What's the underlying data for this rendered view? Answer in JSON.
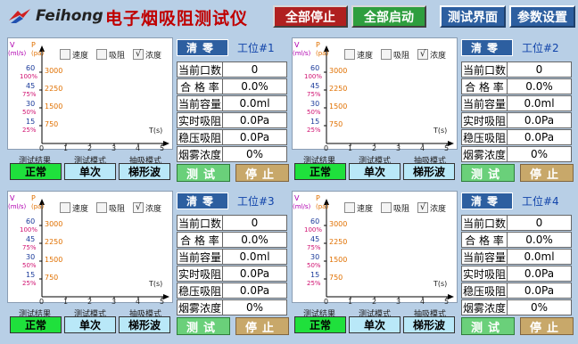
{
  "header": {
    "brand": "Feihong",
    "app_title": "电子烟吸阻测试仪",
    "stop_all": "全部停止",
    "start_all": "全部启动",
    "test_view": "测试界面",
    "params": "参数设置"
  },
  "colors": {
    "background": "#b8cfe6",
    "title_red": "#c00000",
    "result_green": "#1fe03c",
    "blue_button": "#2d5fa0",
    "test_green": "#6ad07a",
    "stop_tan": "#c8a86a"
  },
  "plot_labels": {
    "y1_unit_v": "V",
    "y1_unit": "(ml/s)",
    "y2_unit_p": "P",
    "y2_unit": "(pa)",
    "x_label": "T(s)",
    "y_ticks_left": [
      "60",
      "45",
      "30",
      "15"
    ],
    "y_ticks_pct": [
      "100%",
      "75%",
      "50%",
      "25%"
    ],
    "y_ticks_pa": [
      "3000",
      "2250",
      "1500",
      "750"
    ],
    "x_ticks": [
      "0",
      "1",
      "2",
      "3",
      "4",
      "5"
    ],
    "check_speed": "速度",
    "check_resistance": "吸阻",
    "check_concentration": "浓度",
    "check_mark": "√"
  },
  "labels": {
    "result_label": "测试结果",
    "mode_label": "测试模式",
    "wave_label": "抽吸模式",
    "zero_btn": "清零",
    "test_btn": "测试",
    "stop_btn": "停止",
    "current_puffs": "当前口数",
    "pass_rate": "合 格 率",
    "current_volume": "当前容量",
    "realtime_resistance": "实时吸阻",
    "steady_resistance": "稳压吸阻",
    "smoke_concentration": "烟雾浓度"
  },
  "stations": [
    {
      "title": "工位#1",
      "checks": {
        "speed": false,
        "resistance": false,
        "concentration": true
      },
      "result": "正常",
      "mode": "单次",
      "wave": "梯形波",
      "current_puffs": "0",
      "pass_rate": "0.0%",
      "current_volume": "0.0ml",
      "realtime_resistance": "0.0Pa",
      "steady_resistance": "0.0Pa",
      "smoke_concentration": "0%"
    },
    {
      "title": "工位#2",
      "checks": {
        "speed": false,
        "resistance": false,
        "concentration": true
      },
      "result": "正常",
      "mode": "单次",
      "wave": "梯形波",
      "current_puffs": "0",
      "pass_rate": "0.0%",
      "current_volume": "0.0ml",
      "realtime_resistance": "0.0Pa",
      "steady_resistance": "0.0Pa",
      "smoke_concentration": "0%"
    },
    {
      "title": "工位#3",
      "checks": {
        "speed": false,
        "resistance": false,
        "concentration": true
      },
      "result": "正常",
      "mode": "单次",
      "wave": "梯形波",
      "current_puffs": "0",
      "pass_rate": "0.0%",
      "current_volume": "0.0ml",
      "realtime_resistance": "0.0Pa",
      "steady_resistance": "0.0Pa",
      "smoke_concentration": "0%"
    },
    {
      "title": "工位#4",
      "checks": {
        "speed": false,
        "resistance": false,
        "concentration": true
      },
      "result": "正常",
      "mode": "单次",
      "wave": "梯形波",
      "current_puffs": "0",
      "pass_rate": "0.0%",
      "current_volume": "0.0ml",
      "realtime_resistance": "0.0Pa",
      "steady_resistance": "0.0Pa",
      "smoke_concentration": "0%"
    }
  ]
}
